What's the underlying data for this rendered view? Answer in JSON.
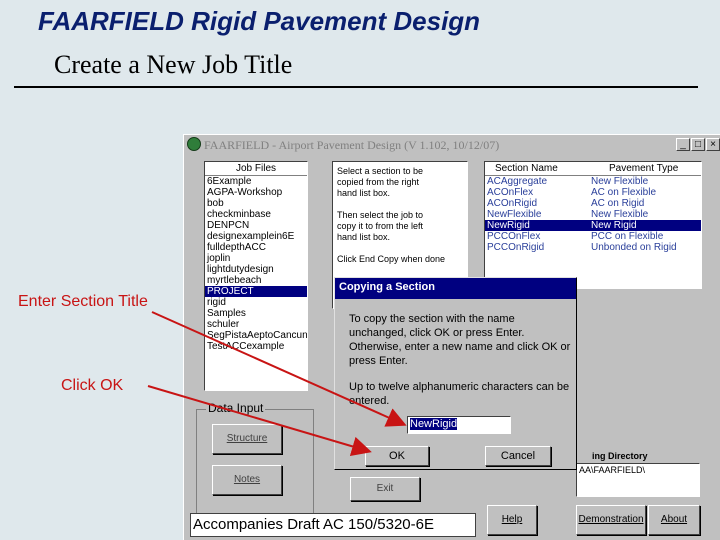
{
  "slide": {
    "title": "FAARFIELD Rigid Pavement Design",
    "subtitle": "Create a New Job Title"
  },
  "callouts": {
    "section_title": "Enter Section Title",
    "click_ok": "Click OK"
  },
  "app": {
    "title": "FAARFIELD - Airport Pavement Design (V 1.102, 10/12/07)",
    "window_buttons": [
      "_",
      "□",
      "×"
    ],
    "job_files_header": "Job Files",
    "job_files": [
      "6Example",
      "AGPA-Workshop",
      "bob",
      "checkminbase",
      "DENPCN",
      "designexamplein6E",
      "fulldepthACC",
      "joplin",
      "lightdutydesign",
      "myrtlebeach",
      "PROJECT",
      "rigid",
      "Samples",
      "schuler",
      "SegPistaAeptoCancun",
      "TestACCexample"
    ],
    "selected_job": "PROJECT",
    "instructions": [
      "Select a section to be",
      "copied from the right",
      "hand list box.",
      "",
      "Then select the job to",
      "copy it to from the left",
      "hand list box.",
      "",
      "Click End Copy when done"
    ],
    "section_header": "Section Name",
    "pavement_header": "Pavement Type",
    "sections": [
      {
        "name": "ACAggregate",
        "type": "New Flexible"
      },
      {
        "name": "ACOnFlex",
        "type": "AC on Flexible"
      },
      {
        "name": "ACOnRigid",
        "type": "AC on Rigid"
      },
      {
        "name": "NewFlexible",
        "type": "New Flexible"
      },
      {
        "name": "NewRigid",
        "type": "New Rigid"
      },
      {
        "name": "PCCOnFlex",
        "type": "PCC on Flexible"
      },
      {
        "name": "PCCOnRigid",
        "type": "Unbonded on Rigid"
      }
    ],
    "selected_section": "NewRigid",
    "data_input_label": "Data Input",
    "structure_button": "Structure",
    "notes_button": "Notes",
    "exit_button": "Exit",
    "working_dir_label": "ing Directory",
    "working_dir_value": "AA\\FAARFIELD\\",
    "caption": "Accompanies Draft AC 150/5320-6E",
    "help_button": "Help",
    "demo_button": "Demonstration",
    "about_button": "About"
  },
  "dialog": {
    "title": "Copying a Section",
    "text1": "To copy the section with the name unchanged, click OK or press Enter. Otherwise, enter a new name and click OK or press Enter.",
    "text2": "Up to twelve alphanumeric characters can be entered.",
    "input_value": "NewRigid",
    "ok_button": "OK",
    "cancel_button": "Cancel"
  },
  "colors": {
    "title_blue": "#0a1f6e",
    "callout_red": "#c81414",
    "selection_navy": "#000080"
  }
}
